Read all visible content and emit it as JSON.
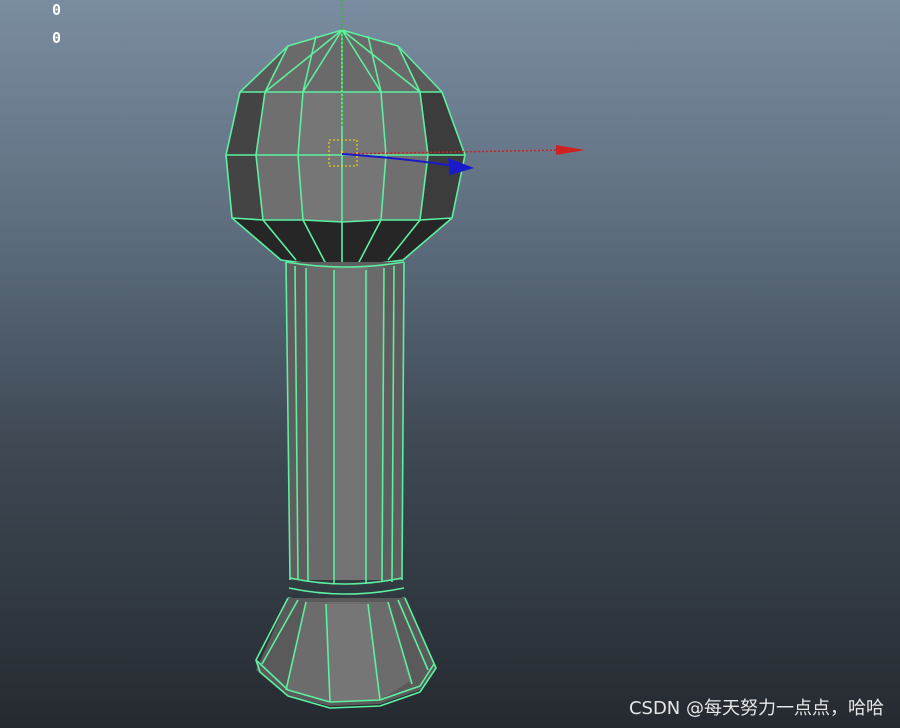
{
  "viewport": {
    "hud_values": [
      "0",
      "0"
    ]
  },
  "colors": {
    "background_top": "#7a8ca0",
    "background_bottom": "#252a30",
    "wireframe": "#5cf0a0",
    "face": "#6e6e6e",
    "gizmo_x": "#cc2222",
    "gizmo_y": "#33bb33",
    "gizmo_z": "#1a1acc",
    "pivot": "#e0d020"
  },
  "selection": {
    "object": "polygon-mesh-pillar",
    "manipulator": "move-tool-gizmo"
  },
  "watermark": "CSDN @每天努力一点点，哈哈"
}
